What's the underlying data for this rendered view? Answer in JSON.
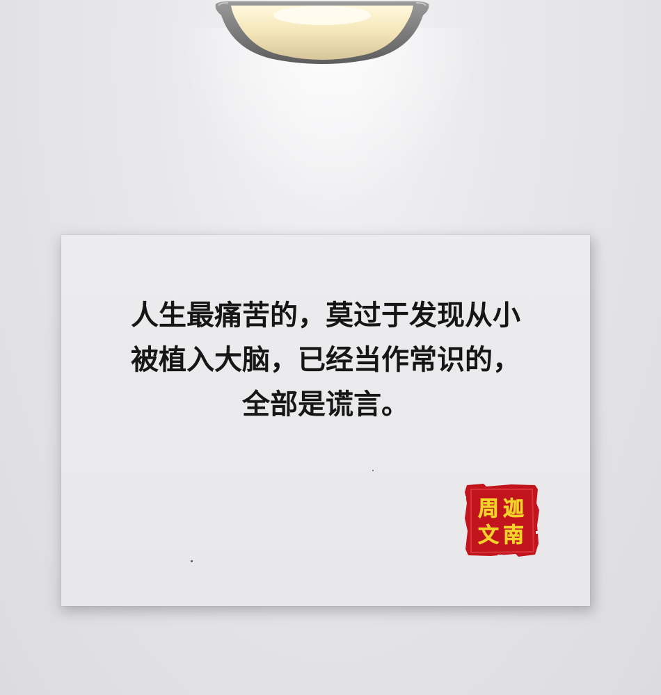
{
  "quote": {
    "line1": "人生最痛苦的，莫过于发现从小",
    "line2": "被植入大脑，已经当作常识的，",
    "line3": "全部是谎言。"
  },
  "seal": {
    "text": "周迦文南",
    "colors": {
      "red": "#c2141c",
      "gold": "#f2d32a"
    }
  },
  "colors": {
    "wall": "#e6e6e9",
    "board": "#eaeaec",
    "text": "#161616"
  }
}
